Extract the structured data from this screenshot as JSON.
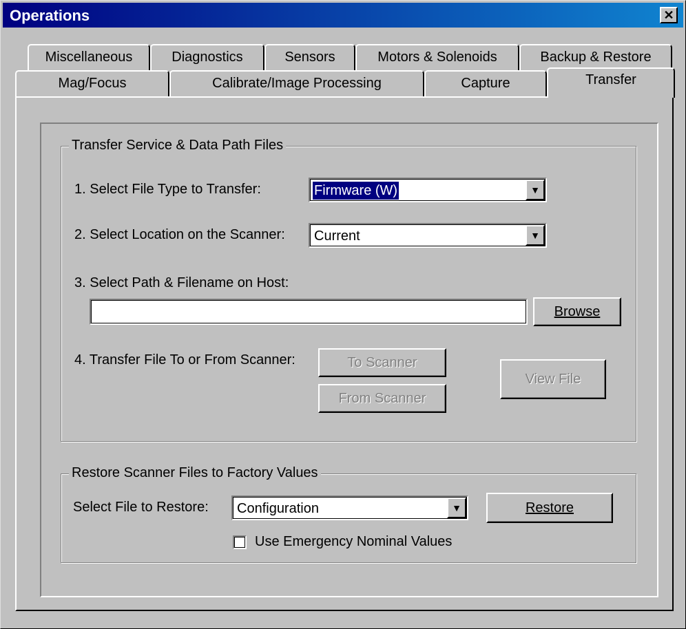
{
  "window": {
    "title": "Operations",
    "close_label": "✕"
  },
  "tabs": {
    "row1": [
      "Miscellaneous",
      "Diagnostics",
      "Sensors",
      "Motors & Solenoids",
      "Backup & Restore"
    ],
    "row2": [
      "Mag/Focus",
      "Calibrate/Image Processing",
      "Capture",
      "Transfer"
    ],
    "active": "Transfer"
  },
  "transfer_group": {
    "title": "Transfer Service & Data Path Files",
    "step1_label": "1. Select File Type to Transfer:",
    "file_type_value": "Firmware (W)",
    "step2_label": "2. Select Location on the Scanner:",
    "location_value": "Current",
    "step3_label": "3. Select Path & Filename on Host:",
    "path_value": "",
    "browse_label": "Browse",
    "step4_label": "4. Transfer File To or From Scanner:",
    "to_scanner_label": "To Scanner",
    "from_scanner_label": "From Scanner",
    "view_file_label": "View File"
  },
  "restore_group": {
    "title": "Restore Scanner Files to Factory Values",
    "select_label": "Select File to Restore:",
    "file_value": "Configuration",
    "restore_label": "Restore",
    "emergency_label": "Use Emergency Nominal Values",
    "emergency_checked": false
  },
  "icons": {
    "dropdown": "triangle-down-icon",
    "close": "close-x-icon"
  }
}
